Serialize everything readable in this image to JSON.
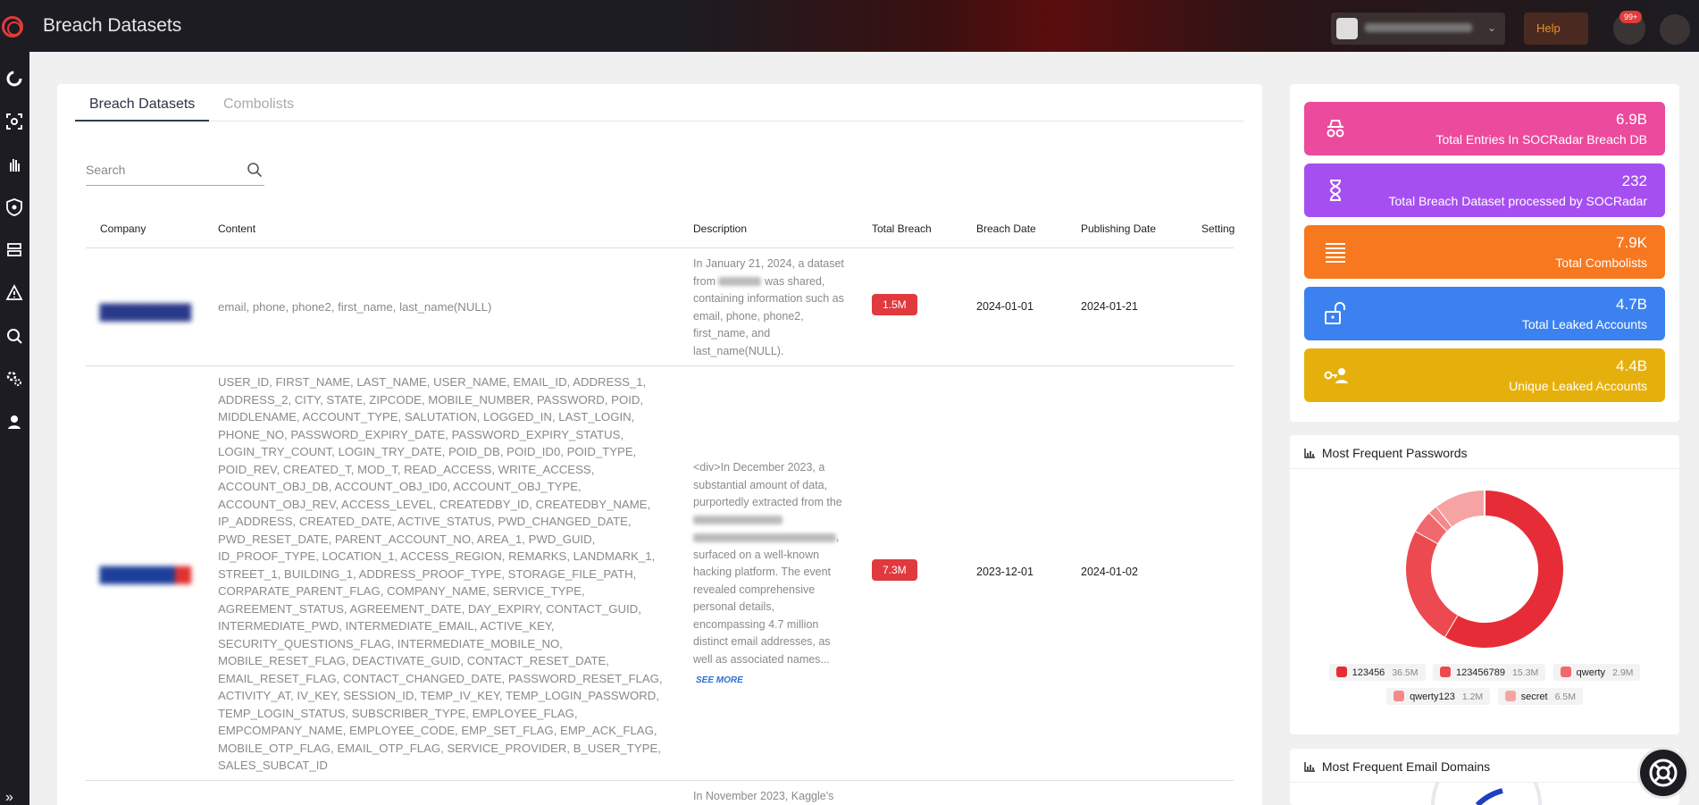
{
  "header": {
    "title": "Breach Datasets",
    "help_label": "Help",
    "notification_count": "99+"
  },
  "tabs": [
    {
      "label": "Breach Datasets",
      "active": true
    },
    {
      "label": "Combolists",
      "active": false
    }
  ],
  "search": {
    "placeholder": "Search",
    "value": ""
  },
  "table": {
    "columns": [
      "Company",
      "Content",
      "Description",
      "Total Breach",
      "Breach Date",
      "Publishing Date",
      "Setting"
    ],
    "rows": [
      {
        "content": "email, phone, phone2, first_name, last_name(NULL)",
        "desc_pre": "In January 21, 2024, a dataset from",
        "desc_post": "was shared, containing information such as email, phone, phone2, first_name, and last_name(NULL).",
        "total": "1.5M",
        "breach_date": "2024-01-01",
        "publish_date": "2024-01-21"
      },
      {
        "content": "USER_ID, FIRST_NAME, LAST_NAME, USER_NAME, EMAIL_ID, ADDRESS_1, ADDRESS_2, CITY, STATE, ZIPCODE, MOBILE_NUMBER, PASSWORD, POID, MIDDLENAME, ACCOUNT_TYPE, SALUTATION, LOGGED_IN, LAST_LOGIN, PHONE_NO, PASSWORD_EXPIRY_DATE, PASSWORD_EXPIRY_STATUS, LOGIN_TRY_COUNT, LOGIN_TRY_DATE, POID_DB, POID_ID0, POID_TYPE, POID_REV, CREATED_T, MOD_T, READ_ACCESS, WRITE_ACCESS, ACCOUNT_OBJ_DB, ACCOUNT_OBJ_ID0, ACCOUNT_OBJ_TYPE, ACCOUNT_OBJ_REV, ACCESS_LEVEL, CREATEDBY_ID, CREATEDBY_NAME, IP_ADDRESS, CREATED_DATE, ACTIVE_STATUS, PWD_CHANGED_DATE, PWD_RESET_DATE, PARENT_ACCOUNT_NO, AREA_1, PWD_GUID, ID_PROOF_TYPE, LOCATION_1, ACCESS_REGION, REMARKS, LANDMARK_1, STREET_1, BUILDING_1, ADDRESS_PROOF_TYPE, STORAGE_FILE_PATH, CORPARATE_PARENT_FLAG, COMPANY_NAME, SERVICE_TYPE, AGREEMENT_STATUS, AGREEMENT_DATE, DAY_EXPIRY, CONTACT_GUID, INTERMEDIATE_PWD, INTERMEDIATE_EMAIL, ACTIVE_KEY, SECURITY_QUESTIONS_FLAG, INTERMEDIATE_MOBILE_NO, MOBILE_RESET_FLAG, DEACTIVATE_GUID, CONTACT_RESET_DATE, EMAIL_RESET_FLAG, CONTACT_CHANGED_DATE, PASSWORD_RESET_FLAG, ACTIVITY_AT, IV_KEY, SESSION_ID, TEMP_IV_KEY, TEMP_LOGIN_PASSWORD, TEMP_LOGIN_STATUS, SUBSCRIBER_TYPE, EMPLOYEE_FLAG, EMPCOMPANY_NAME, EMPLOYEE_CODE, EMP_SET_FLAG, EMP_ACK_FLAG, MOBILE_OTP_FLAG, EMAIL_OTP_FLAG, SERVICE_PROVIDER, B_USER_TYPE, SALES_SUBCAT_ID",
        "desc_pre": "<div>In December 2023, a substantial amount of data, purportedly extracted from the",
        "desc_post": ", surfaced on a well-known hacking platform. The event revealed comprehensive personal details, encompassing 4.7 million distinct email addresses, as well as associated names...",
        "see_more": "SEE MORE",
        "total": "7.3M",
        "breach_date": "2023-12-01",
        "publish_date": "2024-01-02"
      },
      {
        "desc_pre": "In November 2023, Kaggle's"
      }
    ]
  },
  "stats": [
    {
      "value": "6.9B",
      "label": "Total Entries In SOCRadar Breach DB",
      "color": "#ec4a9c",
      "icon": "spy-icon"
    },
    {
      "value": "232",
      "label": "Total Breach Dataset processed by SOCRadar",
      "color": "#a64ff0",
      "icon": "hourglass-icon"
    },
    {
      "value": "7.9K",
      "label": "Total Combolists",
      "color": "#f7781f",
      "icon": "list-icon"
    },
    {
      "value": "4.7B",
      "label": "Total Leaked Accounts",
      "color": "#3b82f0",
      "icon": "unlock-icon"
    },
    {
      "value": "4.4B",
      "label": "Unique Leaked Accounts",
      "color": "#e6b00c",
      "icon": "key-user-icon"
    }
  ],
  "passwords_widget": {
    "title": "Most Frequent Passwords",
    "chart_data": {
      "type": "pie",
      "categories": [
        "123456",
        "123456789",
        "qwerty",
        "qwerty123",
        "secret"
      ],
      "labels": [
        "36.5M",
        "15.3M",
        "2.9M",
        "1.2M",
        "6.5M"
      ],
      "values": [
        36.5,
        15.3,
        2.9,
        1.2,
        6.5
      ],
      "colors": [
        "#e62d37",
        "#ec4a50",
        "#f0696c",
        "#f4898b",
        "#f6a3a3"
      ]
    }
  },
  "domains_widget": {
    "title": "Most Frequent Email Domains"
  }
}
